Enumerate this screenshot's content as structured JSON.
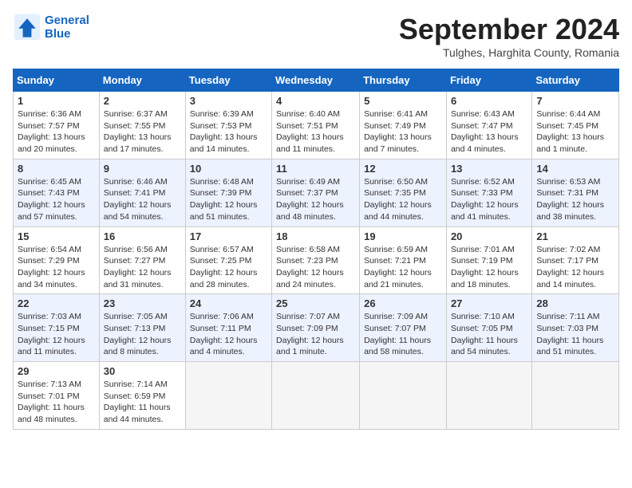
{
  "header": {
    "logo_line1": "General",
    "logo_line2": "Blue",
    "month_title": "September 2024",
    "location": "Tulghes, Harghita County, Romania"
  },
  "days_of_week": [
    "Sunday",
    "Monday",
    "Tuesday",
    "Wednesday",
    "Thursday",
    "Friday",
    "Saturday"
  ],
  "weeks": [
    [
      {
        "day": "1",
        "sunrise": "6:36 AM",
        "sunset": "7:57 PM",
        "daylight": "13 hours and 20 minutes."
      },
      {
        "day": "2",
        "sunrise": "6:37 AM",
        "sunset": "7:55 PM",
        "daylight": "13 hours and 17 minutes."
      },
      {
        "day": "3",
        "sunrise": "6:39 AM",
        "sunset": "7:53 PM",
        "daylight": "13 hours and 14 minutes."
      },
      {
        "day": "4",
        "sunrise": "6:40 AM",
        "sunset": "7:51 PM",
        "daylight": "13 hours and 11 minutes."
      },
      {
        "day": "5",
        "sunrise": "6:41 AM",
        "sunset": "7:49 PM",
        "daylight": "13 hours and 7 minutes."
      },
      {
        "day": "6",
        "sunrise": "6:43 AM",
        "sunset": "7:47 PM",
        "daylight": "13 hours and 4 minutes."
      },
      {
        "day": "7",
        "sunrise": "6:44 AM",
        "sunset": "7:45 PM",
        "daylight": "13 hours and 1 minute."
      }
    ],
    [
      {
        "day": "8",
        "sunrise": "6:45 AM",
        "sunset": "7:43 PM",
        "daylight": "12 hours and 57 minutes."
      },
      {
        "day": "9",
        "sunrise": "6:46 AM",
        "sunset": "7:41 PM",
        "daylight": "12 hours and 54 minutes."
      },
      {
        "day": "10",
        "sunrise": "6:48 AM",
        "sunset": "7:39 PM",
        "daylight": "12 hours and 51 minutes."
      },
      {
        "day": "11",
        "sunrise": "6:49 AM",
        "sunset": "7:37 PM",
        "daylight": "12 hours and 48 minutes."
      },
      {
        "day": "12",
        "sunrise": "6:50 AM",
        "sunset": "7:35 PM",
        "daylight": "12 hours and 44 minutes."
      },
      {
        "day": "13",
        "sunrise": "6:52 AM",
        "sunset": "7:33 PM",
        "daylight": "12 hours and 41 minutes."
      },
      {
        "day": "14",
        "sunrise": "6:53 AM",
        "sunset": "7:31 PM",
        "daylight": "12 hours and 38 minutes."
      }
    ],
    [
      {
        "day": "15",
        "sunrise": "6:54 AM",
        "sunset": "7:29 PM",
        "daylight": "12 hours and 34 minutes."
      },
      {
        "day": "16",
        "sunrise": "6:56 AM",
        "sunset": "7:27 PM",
        "daylight": "12 hours and 31 minutes."
      },
      {
        "day": "17",
        "sunrise": "6:57 AM",
        "sunset": "7:25 PM",
        "daylight": "12 hours and 28 minutes."
      },
      {
        "day": "18",
        "sunrise": "6:58 AM",
        "sunset": "7:23 PM",
        "daylight": "12 hours and 24 minutes."
      },
      {
        "day": "19",
        "sunrise": "6:59 AM",
        "sunset": "7:21 PM",
        "daylight": "12 hours and 21 minutes."
      },
      {
        "day": "20",
        "sunrise": "7:01 AM",
        "sunset": "7:19 PM",
        "daylight": "12 hours and 18 minutes."
      },
      {
        "day": "21",
        "sunrise": "7:02 AM",
        "sunset": "7:17 PM",
        "daylight": "12 hours and 14 minutes."
      }
    ],
    [
      {
        "day": "22",
        "sunrise": "7:03 AM",
        "sunset": "7:15 PM",
        "daylight": "12 hours and 11 minutes."
      },
      {
        "day": "23",
        "sunrise": "7:05 AM",
        "sunset": "7:13 PM",
        "daylight": "12 hours and 8 minutes."
      },
      {
        "day": "24",
        "sunrise": "7:06 AM",
        "sunset": "7:11 PM",
        "daylight": "12 hours and 4 minutes."
      },
      {
        "day": "25",
        "sunrise": "7:07 AM",
        "sunset": "7:09 PM",
        "daylight": "12 hours and 1 minute."
      },
      {
        "day": "26",
        "sunrise": "7:09 AM",
        "sunset": "7:07 PM",
        "daylight": "11 hours and 58 minutes."
      },
      {
        "day": "27",
        "sunrise": "7:10 AM",
        "sunset": "7:05 PM",
        "daylight": "11 hours and 54 minutes."
      },
      {
        "day": "28",
        "sunrise": "7:11 AM",
        "sunset": "7:03 PM",
        "daylight": "11 hours and 51 minutes."
      }
    ],
    [
      {
        "day": "29",
        "sunrise": "7:13 AM",
        "sunset": "7:01 PM",
        "daylight": "11 hours and 48 minutes."
      },
      {
        "day": "30",
        "sunrise": "7:14 AM",
        "sunset": "6:59 PM",
        "daylight": "11 hours and 44 minutes."
      },
      null,
      null,
      null,
      null,
      null
    ]
  ]
}
